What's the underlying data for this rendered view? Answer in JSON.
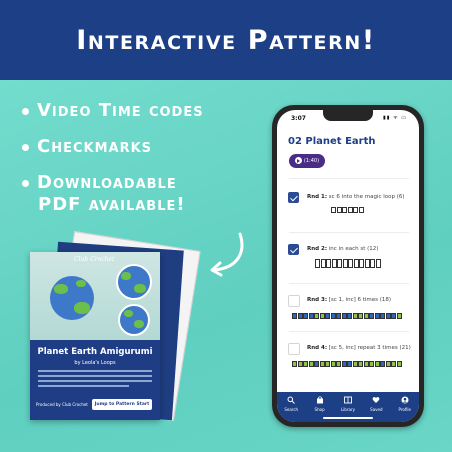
{
  "banner": {
    "title": "Interactive Pattern!"
  },
  "features": [
    {
      "line1": "Video Time codes",
      "line2": ""
    },
    {
      "line1": "Checkmarks",
      "line2": ""
    },
    {
      "line1": "Downloadable",
      "line2": "PDF available!"
    }
  ],
  "pamphlet": {
    "brand": "Club Crochet",
    "title": "Planet Earth Amigurumi",
    "author": "by Leola's Loops",
    "footer": "Produced by Club Crochet",
    "button": "Jump to Pattern Start"
  },
  "phone": {
    "status_time": "3:07",
    "status_icons": "▮▮ ᯤ ▭",
    "header": "02  Planet Earth",
    "video_chip": "(1:40)",
    "rounds": [
      {
        "label": "Rnd 1:",
        "text": "sc 6 into the magic loop (6)",
        "checked": true
      },
      {
        "label": "Rnd 2:",
        "text": "inc in each st (12)",
        "checked": true
      },
      {
        "label": "Rnd 3:",
        "text": "[sc 1, inc] 6 times (18)",
        "checked": false
      },
      {
        "label": "Rnd 4:",
        "text": "[sc 5, inc] repeat 3 times (21)",
        "checked": false
      }
    ],
    "tabs": [
      {
        "label": "Search",
        "icon": "search-icon"
      },
      {
        "label": "Shop",
        "icon": "bag-icon"
      },
      {
        "label": "Library",
        "icon": "library-icon"
      },
      {
        "label": "Saved",
        "icon": "heart-icon"
      },
      {
        "label": "Profile",
        "icon": "profile-icon"
      }
    ]
  },
  "colors": {
    "banner": "#1d3f86",
    "background": "#6fd7c8",
    "checked": "#2c4b95",
    "chip": "#4a2c86",
    "earth_blue": "#2f66b8",
    "earth_green": "#8fc24a"
  }
}
